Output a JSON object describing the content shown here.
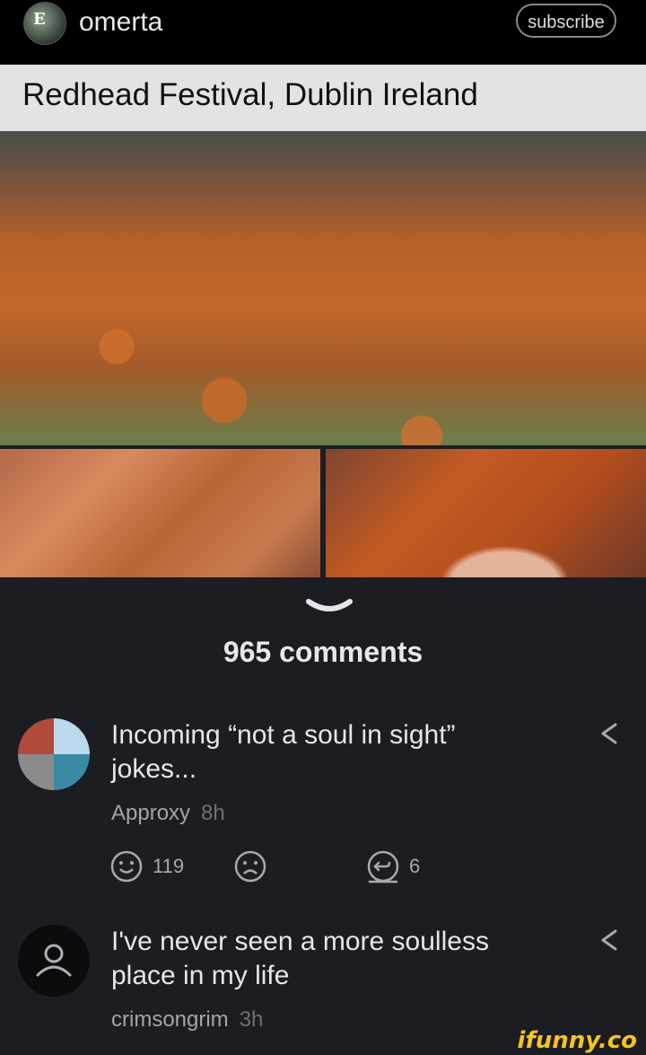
{
  "post": {
    "username": "omerta",
    "subscribe_label": "subscribe",
    "caption": "Redhead Festival,  Dublin  Ireland"
  },
  "comments_count": "965 comments",
  "comments": [
    {
      "text": "Incoming “not a soul in sight” jokes...",
      "author": "Approxy",
      "time": "8h",
      "likes": "119",
      "replies": "6"
    },
    {
      "text": "I've never seen a more soulless place in my life",
      "author": "crimsongrim",
      "time": "3h"
    }
  ],
  "watermark": "ifunny.co",
  "icons": [
    "avatar",
    "chevron-down-icon",
    "smile-icon",
    "frown-icon",
    "reply-icon",
    "share-icon",
    "user-icon"
  ],
  "colors": {
    "background": "#1c1d22",
    "topbar": "#000000",
    "caption_bar": "#e3e3e3",
    "watermark": "#f5c518"
  }
}
